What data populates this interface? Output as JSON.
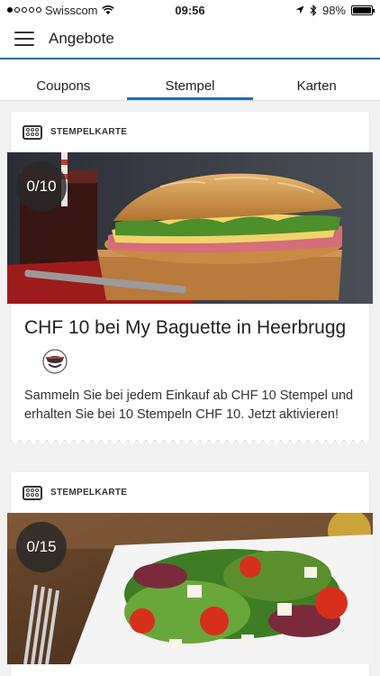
{
  "status_bar": {
    "carrier": "Swisscom",
    "time": "09:56",
    "battery": "98%",
    "battery_level": 0.98,
    "icons": [
      "signal-dots-icon",
      "wifi-icon",
      "location-arrow-icon",
      "bluetooth-icon",
      "battery-icon"
    ]
  },
  "app_bar": {
    "title": "Angebote",
    "menu_icon": "hamburger-menu-icon"
  },
  "colors": {
    "accent": "#1a6eb4",
    "background": "#f2f2f2",
    "card": "#ffffff"
  },
  "tabs": [
    {
      "label": "Coupons",
      "active": false
    },
    {
      "label": "Stempel",
      "active": true
    },
    {
      "label": "Karten",
      "active": false
    }
  ],
  "cards": [
    {
      "type_label": "STEMPELKARTE",
      "type_icon": "stamp-card-icon",
      "counter": "0/10",
      "image": "baguette-sandwich-photo",
      "title": "CHF 10 bei My Baguette in Heerbrugg",
      "logo": "my-baguette-logo",
      "description": "Sammeln Sie bei jedem Einkauf ab CHF 10 Stempel und erhalten Sie bei 10 Stempeln CHF 10. Jetzt aktivieren!"
    },
    {
      "type_label": "STEMPELKARTE",
      "type_icon": "stamp-card-icon",
      "counter": "0/15",
      "image": "salad-photo"
    }
  ]
}
